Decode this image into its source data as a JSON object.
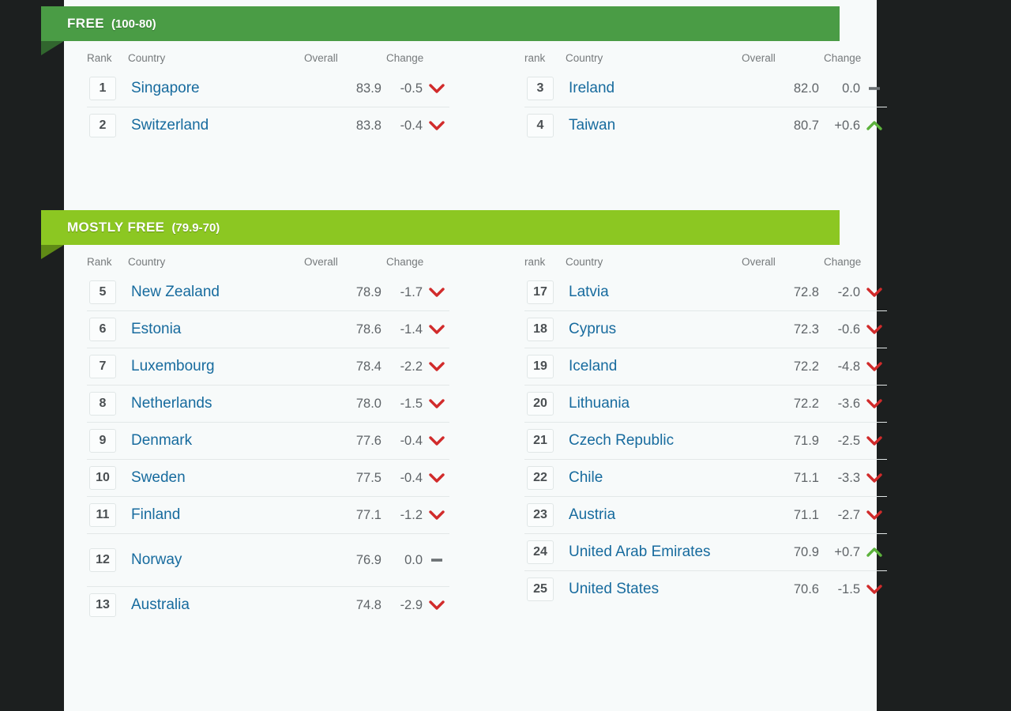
{
  "colors": {
    "banner_free": "#4a9c45",
    "banner_mostly_free": "#8cc722",
    "link": "#176b9e",
    "down_arrow": "#d12b2b",
    "up_arrow": "#5cb23c",
    "flat_dash": "#6b7073",
    "page_background": "#f7fafa",
    "outer_background": "#1c1f1f"
  },
  "sections": [
    {
      "id": "free",
      "title": "FREE",
      "range": "(100-80)",
      "columns": {
        "left": {
          "rank": "Rank",
          "country": "Country",
          "overall": "Overall",
          "change": "Change"
        },
        "right": {
          "rank": "rank",
          "country": "Country",
          "overall": "Overall",
          "change": "Change"
        }
      },
      "left_rows": [
        {
          "rank": "1",
          "country": "Singapore",
          "overall": "83.9",
          "change": "-0.5",
          "direction": "down"
        },
        {
          "rank": "2",
          "country": "Switzerland",
          "overall": "83.8",
          "change": "-0.4",
          "direction": "down"
        }
      ],
      "right_rows": [
        {
          "rank": "3",
          "country": "Ireland",
          "overall": "82.0",
          "change": "0.0",
          "direction": "flat"
        },
        {
          "rank": "4",
          "country": "Taiwan",
          "overall": "80.7",
          "change": "+0.6",
          "direction": "up"
        }
      ]
    },
    {
      "id": "mostly-free",
      "title": "MOSTLY FREE",
      "range": "(79.9-70)",
      "columns": {
        "left": {
          "rank": "Rank",
          "country": "Country",
          "overall": "Overall",
          "change": "Change"
        },
        "right": {
          "rank": "rank",
          "country": "Country",
          "overall": "Overall",
          "change": "Change"
        }
      },
      "left_rows": [
        {
          "rank": "5",
          "country": "New Zealand",
          "overall": "78.9",
          "change": "-1.7",
          "direction": "down"
        },
        {
          "rank": "6",
          "country": "Estonia",
          "overall": "78.6",
          "change": "-1.4",
          "direction": "down"
        },
        {
          "rank": "7",
          "country": "Luxembourg",
          "overall": "78.4",
          "change": "-2.2",
          "direction": "down"
        },
        {
          "rank": "8",
          "country": "Netherlands",
          "overall": "78.0",
          "change": "-1.5",
          "direction": "down"
        },
        {
          "rank": "9",
          "country": "Denmark",
          "overall": "77.6",
          "change": "-0.4",
          "direction": "down"
        },
        {
          "rank": "10",
          "country": "Sweden",
          "overall": "77.5",
          "change": "-0.4",
          "direction": "down"
        },
        {
          "rank": "11",
          "country": "Finland",
          "overall": "77.1",
          "change": "-1.2",
          "direction": "down"
        },
        {
          "rank": "12",
          "country": "Norway",
          "overall": "76.9",
          "change": "0.0",
          "direction": "flat",
          "tall": true
        },
        {
          "rank": "13",
          "country": "Australia",
          "overall": "74.8",
          "change": "-2.9",
          "direction": "down"
        }
      ],
      "right_rows": [
        {
          "rank": "17",
          "country": "Latvia",
          "overall": "72.8",
          "change": "-2.0",
          "direction": "down"
        },
        {
          "rank": "18",
          "country": "Cyprus",
          "overall": "72.3",
          "change": "-0.6",
          "direction": "down"
        },
        {
          "rank": "19",
          "country": "Iceland",
          "overall": "72.2",
          "change": "-4.8",
          "direction": "down"
        },
        {
          "rank": "20",
          "country": "Lithuania",
          "overall": "72.2",
          "change": "-3.6",
          "direction": "down"
        },
        {
          "rank": "21",
          "country": "Czech Republic",
          "overall": "71.9",
          "change": "-2.5",
          "direction": "down"
        },
        {
          "rank": "22",
          "country": "Chile",
          "overall": "71.1",
          "change": "-3.3",
          "direction": "down"
        },
        {
          "rank": "23",
          "country": "Austria",
          "overall": "71.1",
          "change": "-2.7",
          "direction": "down"
        },
        {
          "rank": "24",
          "country": "United Arab Emirates",
          "overall": "70.9",
          "change": "+0.7",
          "direction": "up"
        },
        {
          "rank": "25",
          "country": "United States",
          "overall": "70.6",
          "change": "-1.5",
          "direction": "down"
        }
      ]
    }
  ]
}
